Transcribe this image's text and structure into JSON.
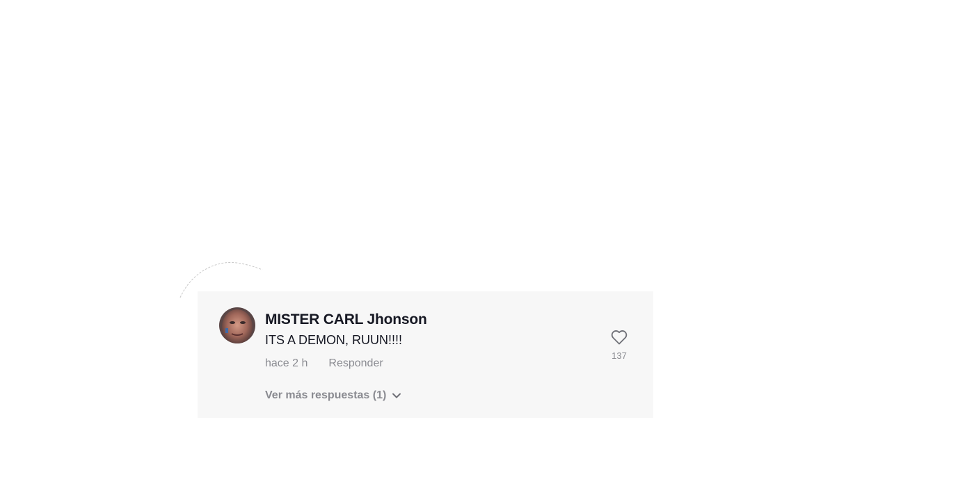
{
  "comment": {
    "author": "MISTER CARL Jhonson",
    "text": "ITS A DEMON, RUUN!!!!",
    "time": "hace 2 h",
    "reply_label": "Responder",
    "like_count": "137",
    "more_replies_label": "Ver más respuestas (1)"
  },
  "icons": {
    "like": "heart-outline-icon",
    "expand": "chevron-down-icon"
  },
  "colors": {
    "card_background": "#f7f7f7",
    "primary_text": "#161823",
    "secondary_text": "#8a8b91"
  }
}
